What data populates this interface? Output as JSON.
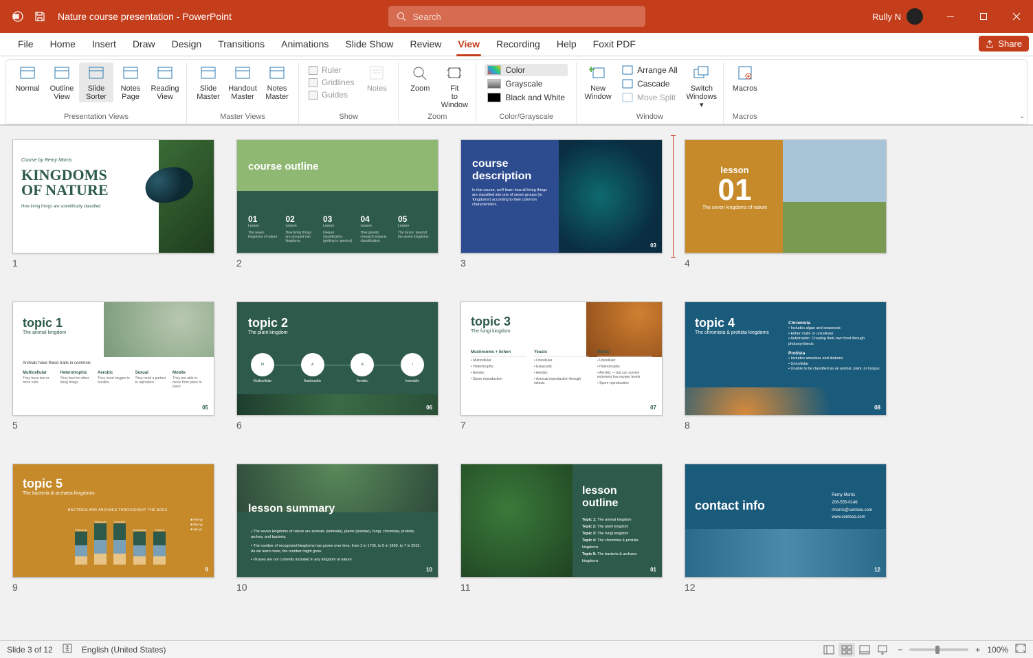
{
  "app": {
    "doc_title": "Nature course presentation  -  PowerPoint",
    "user_name": "Rully N"
  },
  "search": {
    "placeholder": "Search"
  },
  "tabs": {
    "items": [
      {
        "label": "File"
      },
      {
        "label": "Home"
      },
      {
        "label": "Insert"
      },
      {
        "label": "Draw"
      },
      {
        "label": "Design"
      },
      {
        "label": "Transitions"
      },
      {
        "label": "Animations"
      },
      {
        "label": "Slide Show"
      },
      {
        "label": "Review"
      },
      {
        "label": "View"
      },
      {
        "label": "Recording"
      },
      {
        "label": "Help"
      },
      {
        "label": "Foxit PDF"
      }
    ],
    "selected_index": 9,
    "share_label": "Share"
  },
  "ribbon": {
    "groups": {
      "presentation_views": {
        "label": "Presentation Views",
        "buttons": [
          {
            "label": "Normal"
          },
          {
            "label": "Outline View"
          },
          {
            "label": "Slide Sorter"
          },
          {
            "label": "Notes Page"
          },
          {
            "label": "Reading View"
          }
        ],
        "active_index": 2
      },
      "master_views": {
        "label": "Master Views",
        "buttons": [
          {
            "label": "Slide Master"
          },
          {
            "label": "Handout Master"
          },
          {
            "label": "Notes Master"
          }
        ]
      },
      "show": {
        "label": "Show",
        "checks": [
          {
            "label": "Ruler"
          },
          {
            "label": "Gridlines"
          },
          {
            "label": "Guides"
          }
        ],
        "notes_label": "Notes"
      },
      "zoom": {
        "label": "Zoom",
        "buttons": [
          {
            "label": "Zoom"
          },
          {
            "label": "Fit to Window"
          }
        ]
      },
      "color": {
        "label": "Color/Grayscale",
        "items": [
          {
            "label": "Color"
          },
          {
            "label": "Grayscale"
          },
          {
            "label": "Black and White"
          }
        ],
        "active_index": 0
      },
      "window": {
        "label": "Window",
        "big_label": "New Window",
        "items": [
          {
            "label": "Arrange All"
          },
          {
            "label": "Cascade"
          },
          {
            "label": "Move Split",
            "disabled": true
          }
        ],
        "switch_label": "Switch Windows"
      },
      "macros": {
        "label": "Macros",
        "button_label": "Macros"
      }
    }
  },
  "slides": [
    {
      "num": "1",
      "title": "KINGDOMS OF NATURE",
      "subtitle": "How living things are scientifically classified",
      "byline": "Course by Remy Morris"
    },
    {
      "num": "2",
      "title": "course outline",
      "items": [
        "01 Lesson",
        "02 Lesson",
        "03 Lesson",
        "04 Lesson",
        "05 Lesson"
      ],
      "descs": [
        "The seven kingdoms of nature",
        "How living things are grouped into kingdoms",
        "Deeper classification (getting to species)",
        "How genetic research impacts classification",
        "The future: beyond the seven kingdoms"
      ]
    },
    {
      "num": "3",
      "title": "course description",
      "body": "In this course, we'll learn how all living things are classified into one of seven groups (or 'kingdoms') according to their common characteristics.",
      "page": "03"
    },
    {
      "num": "4",
      "title": "lesson",
      "big": "01",
      "subtitle": "The seven kingdoms of nature"
    },
    {
      "num": "5",
      "title": "topic 1",
      "subtitle": "The animal kingdom",
      "lead": "Animals have these traits in common:",
      "cols": [
        "Multicellular",
        "Heterotrophic",
        "Aerobic",
        "Sexual",
        "Mobile"
      ],
      "notes": [
        "They have two or more cells",
        "They feed on other living things",
        "They need oxygen to breathe",
        "They need a partner to reproduce",
        "They are able to move from place to place"
      ],
      "page": "05"
    },
    {
      "num": "6",
      "title": "topic 2",
      "subtitle": "The plant kingdom",
      "icons": [
        "Multicellular",
        "Autotrophic",
        "Aerobic",
        "Immobile"
      ],
      "page": "06"
    },
    {
      "num": "7",
      "title": "topic 3",
      "subtitle": "The fungi kingdom",
      "headers": [
        "Mushrooms + lichen",
        "Yeasts",
        "Molds"
      ],
      "rows": [
        [
          "Multicellular",
          "Unicellular",
          "Unicellular"
        ],
        [
          "Heterotrophic",
          "Eukaryotic",
          "Heterotrophic"
        ],
        [
          "Aerobic",
          "Aerobic",
          "Aerobic — but can survive extremely low oxygen levels"
        ],
        [
          "Spore reproduction",
          "Asexual reproduction through mitosis",
          "Spore reproduction"
        ]
      ],
      "page": "07"
    },
    {
      "num": "8",
      "title": "topic 4",
      "subtitle": "The chromista & protista kingdoms",
      "sections": {
        "Chromista": [
          "Includes algae and seaweeds",
          "Either multi- or unicellular",
          "Autotrophic: Creating their own food through photosynthesis"
        ],
        "Protista": [
          "Includes amoebas and diatoms",
          "Unicellular",
          "Unable to be classified as an animal, plant, or fungus"
        ]
      },
      "page": "08"
    },
    {
      "num": "9",
      "title": "topic 5",
      "subtitle": "The bacteria & archaea kingdoms",
      "chart_caption": "BACTERIA AND ARCHAEA THROUGHOUT THE AGES",
      "page": "9"
    },
    {
      "num": "10",
      "title": "lesson summary",
      "bullets": [
        "The seven kingdoms of nature are animals (animalia), plants (plantae), fungi, chromista, protista, archea, and bacteria.",
        "The number of recognized kingdoms has grown over time, from 2 in 1735, to 5 in 1969, to 7 in 2015. As we learn more, the number might grow.",
        "Viruses are not currently included in any kingdom of nature."
      ],
      "page": "10"
    },
    {
      "num": "11",
      "title": "lesson outline",
      "rows": [
        "Topic 1: The animal kingdom",
        "Topic 2: The plant kingdom",
        "Topic 3: The fungi kingdom",
        "Topic 4: The chromista & protista kingdoms",
        "Topic 5: The bacteria & archaea kingdoms"
      ],
      "page": "01"
    },
    {
      "num": "12",
      "title": "contact info",
      "lines": [
        "Remy Morris",
        "206-555-0146",
        "rmorris@contoso.com",
        "www.contoso.com"
      ],
      "page": "12"
    }
  ],
  "chart_data": {
    "slide": 9,
    "type": "bar",
    "stacked": true,
    "title": "BACTERIA AND ARCHAEA THROUGHOUT THE AGES",
    "categories": [
      "Paleozoic",
      "Mesozoic",
      "Cenozoic",
      "Quaternary",
      "Present"
    ],
    "series": [
      {
        "name": "Feb-yy",
        "values": [
          3,
          4,
          4,
          3,
          3
        ]
      },
      {
        "name": "Mar-yy",
        "values": [
          4,
          5,
          5,
          4,
          4
        ]
      },
      {
        "name": "Apr-yy",
        "values": [
          5,
          6,
          6,
          5,
          5
        ]
      }
    ],
    "ylim": [
      0,
      15
    ]
  },
  "status": {
    "slide_indicator": "Slide 3 of 12",
    "language": "English (United States)",
    "zoom_label": "100%"
  },
  "colors": {
    "accent": "#c43e1c"
  }
}
